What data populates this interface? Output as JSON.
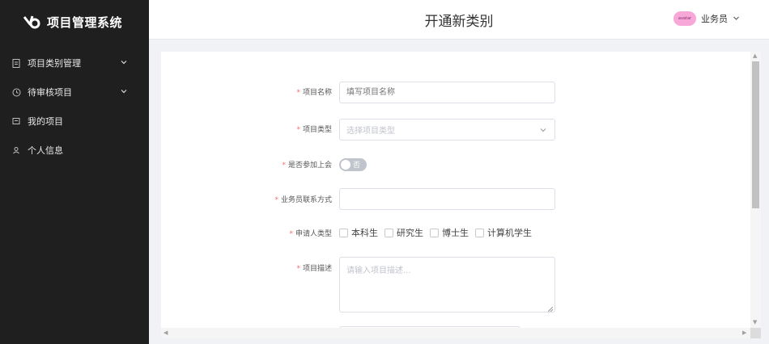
{
  "app": {
    "title": "项目管理系统"
  },
  "sidebar": {
    "items": [
      {
        "label": "项目类别管理",
        "icon": "document-icon",
        "has_submenu": true
      },
      {
        "label": "待审核项目",
        "icon": "clock-icon",
        "has_submenu": true
      },
      {
        "label": "我的项目",
        "icon": "folder-icon",
        "has_submenu": false
      },
      {
        "label": "个人信息",
        "icon": "user-icon",
        "has_submenu": false
      }
    ]
  },
  "header": {
    "title": "开通新类别",
    "user_name": "业务员",
    "avatar_text": "avatar"
  },
  "form": {
    "name": {
      "label": "项目名称",
      "placeholder": "填写项目名称",
      "value": ""
    },
    "type": {
      "label": "项目类型",
      "placeholder": "选择项目类型",
      "value": ""
    },
    "meeting": {
      "label": "是否参加上会",
      "switch_text": "否",
      "on": false
    },
    "contact": {
      "label": "业务员联系方式",
      "value": ""
    },
    "applicant": {
      "label": "申请人类型",
      "options": [
        {
          "label": "本科生",
          "checked": false
        },
        {
          "label": "研究生",
          "checked": false
        },
        {
          "label": "博士生",
          "checked": false
        },
        {
          "label": "计算机学生",
          "checked": false
        }
      ]
    },
    "description": {
      "label": "项目描述",
      "placeholder": "请输入项目描述...",
      "value": ""
    }
  },
  "colors": {
    "sidebar_bg": "#1f1f1f",
    "required": "#f56c6c",
    "border": "#dcdfe6",
    "avatar": "#f7a8d8"
  }
}
